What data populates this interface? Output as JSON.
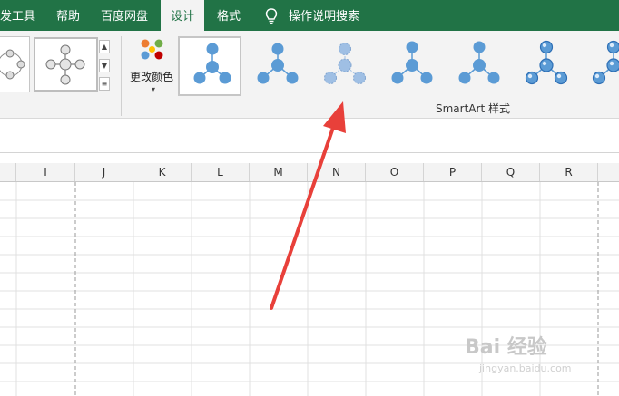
{
  "tabs": [
    {
      "label": "发工具",
      "active": false
    },
    {
      "label": "帮助",
      "active": false
    },
    {
      "label": "百度网盘",
      "active": false
    },
    {
      "label": "设计",
      "active": true
    },
    {
      "label": "格式",
      "active": false
    }
  ],
  "tell_me": {
    "label": "操作说明搜索"
  },
  "ribbon": {
    "change_colors_label": "更改颜色",
    "group_label": "SmartArt 样式",
    "style_count": 7,
    "selected_style": 1
  },
  "columns": [
    "I",
    "J",
    "K",
    "L",
    "M",
    "N",
    "O",
    "P",
    "Q",
    "R"
  ],
  "colors": {
    "excel_green": "#217346",
    "node_blue": "#5b9bd5",
    "arrow_red": "#e8403a"
  },
  "watermark": {
    "brand": "Bai 经验",
    "url": "jingyan.baidu.com"
  }
}
